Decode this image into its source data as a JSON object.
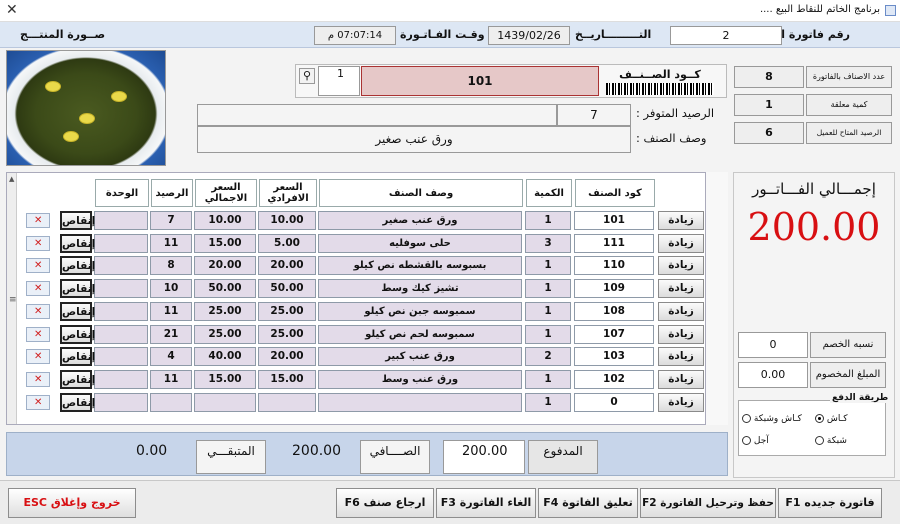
{
  "window": {
    "title": "برنامج الخاتم للنقاط البيع ....",
    "close_glyph": "✕"
  },
  "header": {
    "invoice_no_label": "رقم فاتورة البيع",
    "invoice_no": "2",
    "date_label": "التـــــــــاريــخ",
    "date": "1439/02/26",
    "time_label": "وقـت الفـاتـورة",
    "time": "07:07:14 م",
    "photo_label": "صــورة المنتـــج"
  },
  "product": {
    "code_label": "كــود الصــنــف",
    "code": "101",
    "qty": "1",
    "balance_label": "الرصيد المتوفر :",
    "balance": "7",
    "desc_label": "وصف الصنف :",
    "desc": "ورق عنب صغير",
    "search_icon": "magnifier-icon"
  },
  "stats": [
    {
      "label": "عدد الاصناف بالفاتورة",
      "value": "8"
    },
    {
      "label": "كمية معلقة",
      "value": "1"
    },
    {
      "label": "الرصيد المتاح للعميل",
      "value": "6"
    }
  ],
  "grid": {
    "headers": {
      "code": "كود الصنف",
      "qty": "الكمية",
      "desc": "وصف الصنف",
      "unit_price": "السعر الافرادي",
      "total_price": "السعر الاجمالي",
      "balance": "الرصيد",
      "unit": "الوحدة"
    },
    "add_label": "زيادة",
    "reduce_label": "إنقاص",
    "delete_icon": "delete-row-icon",
    "rows": [
      {
        "code": "101",
        "qty": "1",
        "desc": "ورق عنب صغير",
        "unit_price": "10.00",
        "total_price": "10.00",
        "balance": "7"
      },
      {
        "code": "111",
        "qty": "3",
        "desc": "حلى سوفليه",
        "unit_price": "5.00",
        "total_price": "15.00",
        "balance": "11"
      },
      {
        "code": "110",
        "qty": "1",
        "desc": "بسبوسه بالقشطه نص كيلو",
        "unit_price": "20.00",
        "total_price": "20.00",
        "balance": "8"
      },
      {
        "code": "109",
        "qty": "1",
        "desc": "تشيز كيك وسط",
        "unit_price": "50.00",
        "total_price": "50.00",
        "balance": "10"
      },
      {
        "code": "108",
        "qty": "1",
        "desc": "سمبوسه جبن نص كيلو",
        "unit_price": "25.00",
        "total_price": "25.00",
        "balance": "11"
      },
      {
        "code": "107",
        "qty": "1",
        "desc": "سمبوسه لحم نص كيلو",
        "unit_price": "25.00",
        "total_price": "25.00",
        "balance": "21"
      },
      {
        "code": "103",
        "qty": "2",
        "desc": "ورق عنب كبير",
        "unit_price": "20.00",
        "total_price": "40.00",
        "balance": "4"
      },
      {
        "code": "102",
        "qty": "1",
        "desc": "ورق عنب وسط",
        "unit_price": "15.00",
        "total_price": "15.00",
        "balance": "11"
      },
      {
        "code": "0",
        "qty": "1",
        "desc": "",
        "unit_price": "",
        "total_price": "",
        "balance": ""
      }
    ]
  },
  "totals": {
    "title": "إجمـــالي الفـــاتــور",
    "amount": "200.00",
    "discount_pct_label": "نسبه الخصم",
    "discount_pct": "0",
    "discount_amount_label": "المبلغ المخصوم",
    "discount_amount": "0.00",
    "payment_method_label": "طريقة الدفع",
    "payment_methods": [
      "كـاش",
      "كـاش وشبكة",
      "شبكة",
      "آجل"
    ]
  },
  "payment": {
    "paid_label": "المدفوع",
    "paid": "200.00",
    "net_label": "الصــــافي",
    "net": "200.00",
    "remaining_label": "المتبقـــي",
    "remaining": "0.00"
  },
  "footer": {
    "new_invoice": "فاتورة جديده F1",
    "save_post": "حفظ وترحيل الفاتورة F2",
    "suspend": "تعليق الفاتوة F4",
    "cancel": "الغاء الفاتورة F3",
    "return_item": "ارجاع صنف F6",
    "exit": "خروج وإغلاق ESC"
  },
  "colors": {
    "accent_red": "#d80f12",
    "grid_lavender": "#e3dbe9",
    "panel_blue": "#c7d5ea"
  }
}
